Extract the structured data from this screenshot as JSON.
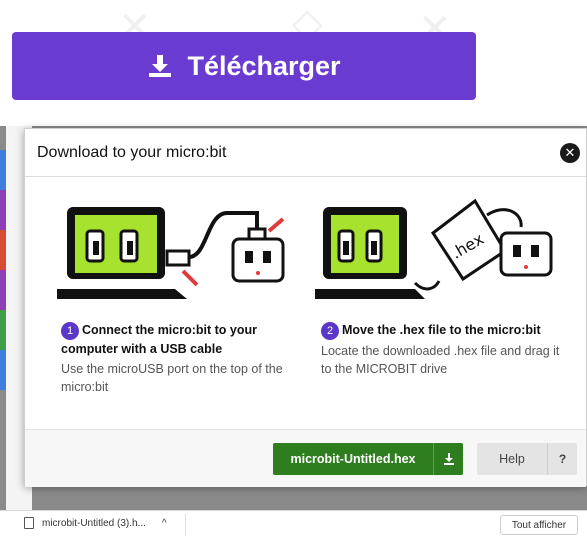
{
  "toolbar": {
    "download_label": "Télécharger"
  },
  "modal": {
    "title": "Download to your micro:bit",
    "close_icon": "close-icon",
    "steps": [
      {
        "number": "1",
        "title": "Connect the micro:bit to your computer with a USB cable",
        "desc": "Use the microUSB port on the top of the micro:bit"
      },
      {
        "number": "2",
        "title": "Move the .hex file to the micro:bit",
        "desc": "Locate the downloaded .hex file and drag it to the MICROBIT drive"
      }
    ],
    "illustration_label": ".hex",
    "file_button_label": "microbit-Untitled.hex",
    "help_label": "Help",
    "help_q": "?"
  },
  "download_bar": {
    "file_label": "microbit-Untitled (3).h...",
    "chevron": "^",
    "show_all_label": "Tout afficher"
  },
  "colors": {
    "purple": "#6a3bd1",
    "green": "#2e7d1e",
    "lime": "#a6e22e"
  }
}
